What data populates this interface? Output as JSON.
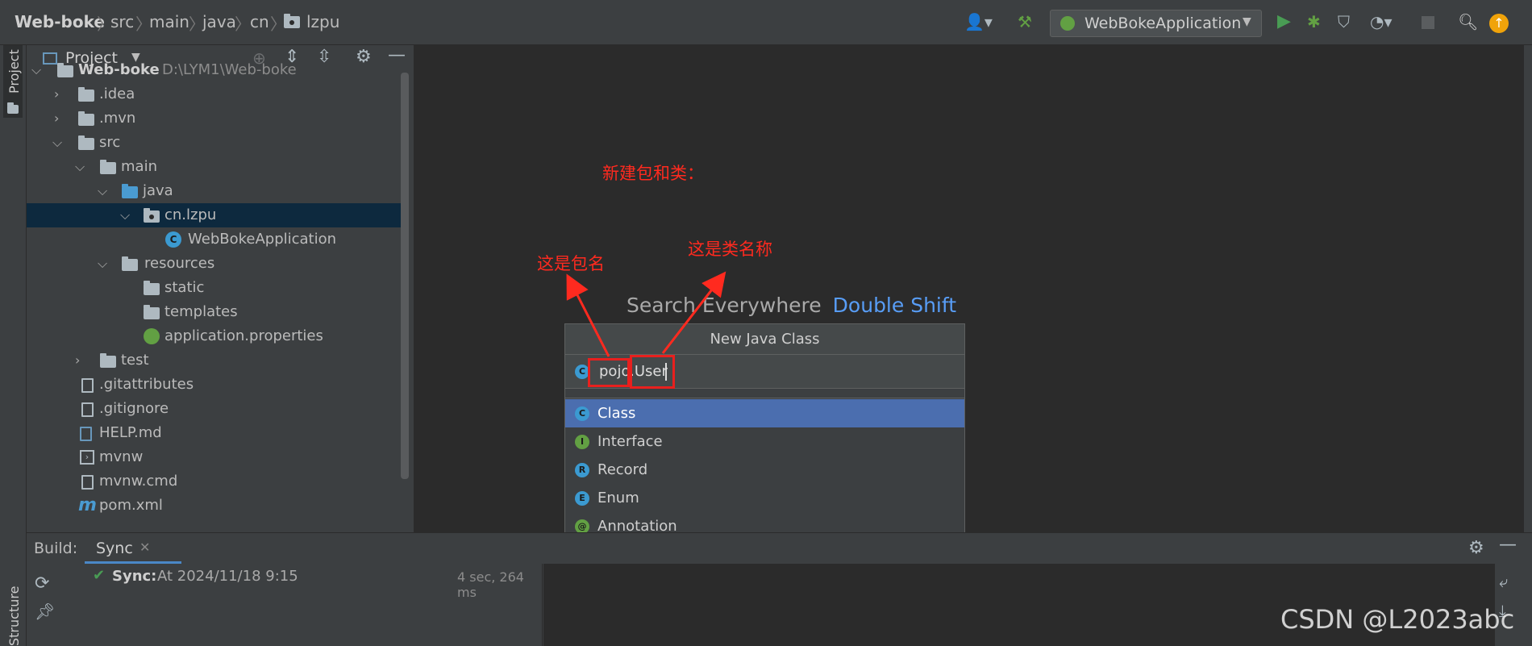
{
  "breadcrumb": {
    "items": [
      "Web-boke",
      "src",
      "main",
      "java",
      "cn",
      "lzpu"
    ]
  },
  "toolbar": {
    "run_config": "WebBokeApplication",
    "icons": [
      "user-icon",
      "hammer-icon",
      "run-icon",
      "debug-icon",
      "coverage-icon",
      "profiler-icon",
      "stop-icon",
      "search-icon",
      "update-icon"
    ]
  },
  "left_stripe": {
    "project_label": "Project",
    "structure_label": "Structure"
  },
  "project_panel": {
    "title": "Project",
    "tree": [
      {
        "label": "Web-boke",
        "path": "D:\\LYM1\\Web-boke"
      },
      {
        "label": ".idea"
      },
      {
        "label": ".mvn"
      },
      {
        "label": "src"
      },
      {
        "label": "main"
      },
      {
        "label": "java"
      },
      {
        "label": "cn.lzpu"
      },
      {
        "label": "WebBokeApplication"
      },
      {
        "label": "resources"
      },
      {
        "label": "static"
      },
      {
        "label": "templates"
      },
      {
        "label": "application.properties"
      },
      {
        "label": "test"
      },
      {
        "label": ".gitattributes"
      },
      {
        "label": ".gitignore"
      },
      {
        "label": "HELP.md"
      },
      {
        "label": "mvnw"
      },
      {
        "label": "mvnw.cmd"
      },
      {
        "label": "pom.xml"
      }
    ]
  },
  "editor": {
    "search_hint": "Search Everywhere",
    "search_shortcut": "Double Shift"
  },
  "dialog": {
    "title": "New Java Class",
    "input_value": "pojo.User",
    "options": [
      {
        "icon": "C",
        "label": "Class",
        "selected": true
      },
      {
        "icon": "I",
        "label": "Interface"
      },
      {
        "icon": "R",
        "label": "Record"
      },
      {
        "icon": "E",
        "label": "Enum"
      },
      {
        "icon": "@",
        "label": "Annotation"
      }
    ]
  },
  "annotations": {
    "heading": "新建包和类：",
    "package_note": "这是包名",
    "class_note": "这是类名称"
  },
  "build": {
    "label": "Build:",
    "tab": "Sync",
    "status_title": "Sync:",
    "status_text": "At 2024/11/18 9:15",
    "duration": "4 sec, 264 ms"
  },
  "watermark": "CSDN @L2023abc",
  "colors": {
    "selection": "#4b6eaf",
    "link": "#589df6",
    "annotation": "#ff2a1f",
    "run_green": "#499c54"
  }
}
